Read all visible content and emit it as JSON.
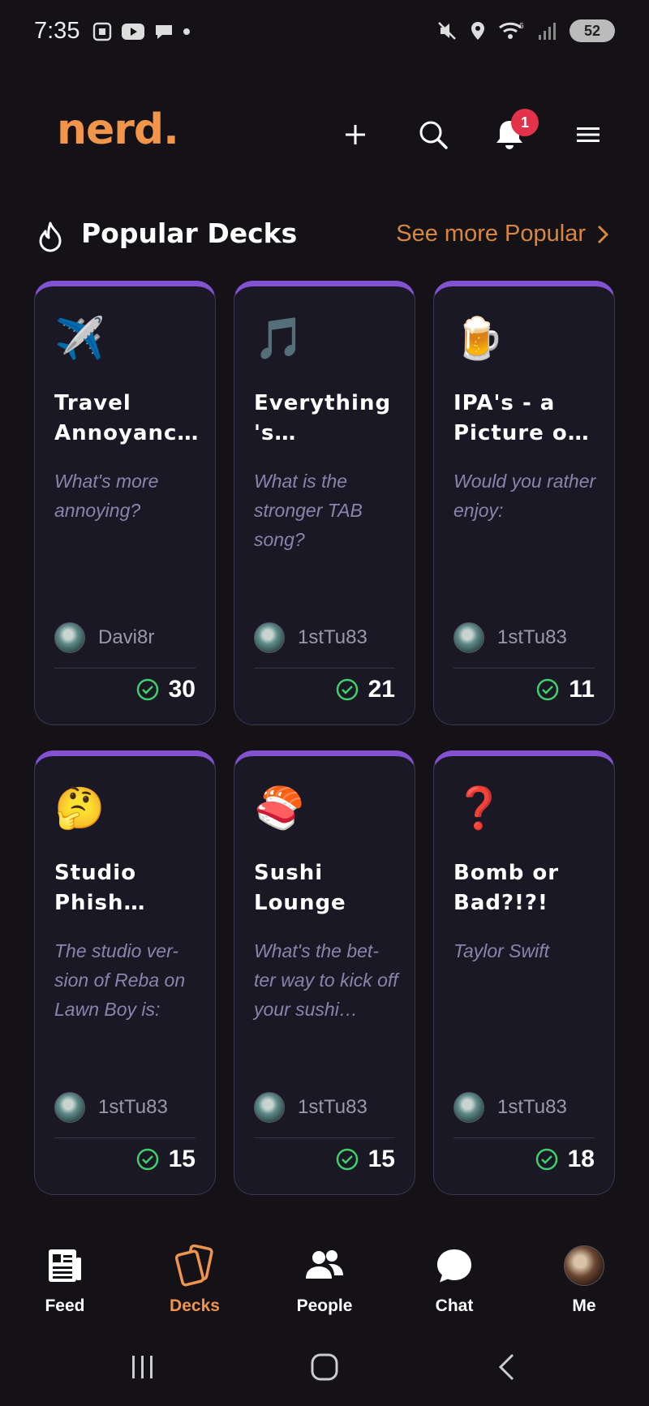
{
  "status_bar": {
    "time": "7:35",
    "signal_sup": "6",
    "battery": "52"
  },
  "header": {
    "logo": "nerd.",
    "notifications_count": "1"
  },
  "section": {
    "title": "Popular Decks",
    "see_more": "See more Popular"
  },
  "decks": [
    {
      "emoji": "✈️",
      "title": "Travel Annoyanc…",
      "description": "What's more annoying?",
      "author": "Davi8r",
      "count": "30"
    },
    {
      "emoji": "🎵",
      "title": "Everything 's…",
      "description": "What is the stronger TAB song?",
      "author": "1stTu83",
      "count": "21"
    },
    {
      "emoji": "🍺",
      "title": "IPA's - a Picture o…",
      "description": "Would you rather enjoy:",
      "author": "1stTu83",
      "count": "11"
    },
    {
      "emoji": "🤔",
      "title": "Studio Phish…",
      "description": "The studio ver-sion of Reba on Lawn Boy is:",
      "author": "1stTu83",
      "count": "15"
    },
    {
      "emoji": "🍣",
      "title": "Sushi Lounge",
      "description": "What's the bet-ter way to kick off your sushi…",
      "author": "1stTu83",
      "count": "15"
    },
    {
      "emoji": "❓",
      "title": "Bomb or Bad?!?!",
      "description": "Taylor Swift",
      "author": "1stTu83",
      "count": "18"
    }
  ],
  "bottom_nav": {
    "items": [
      {
        "label": "Feed",
        "icon": "feed-icon"
      },
      {
        "label": "Decks",
        "icon": "decks-icon",
        "active": true
      },
      {
        "label": "People",
        "icon": "people-icon"
      },
      {
        "label": "Chat",
        "icon": "chat-icon"
      },
      {
        "label": "Me",
        "icon": "avatar"
      }
    ]
  },
  "colors": {
    "background": "#141117",
    "accent_orange": "#f0954a",
    "card_top_purple": "#8352d1",
    "check_green": "#3fcf6b",
    "badge_red": "#e3334a"
  }
}
